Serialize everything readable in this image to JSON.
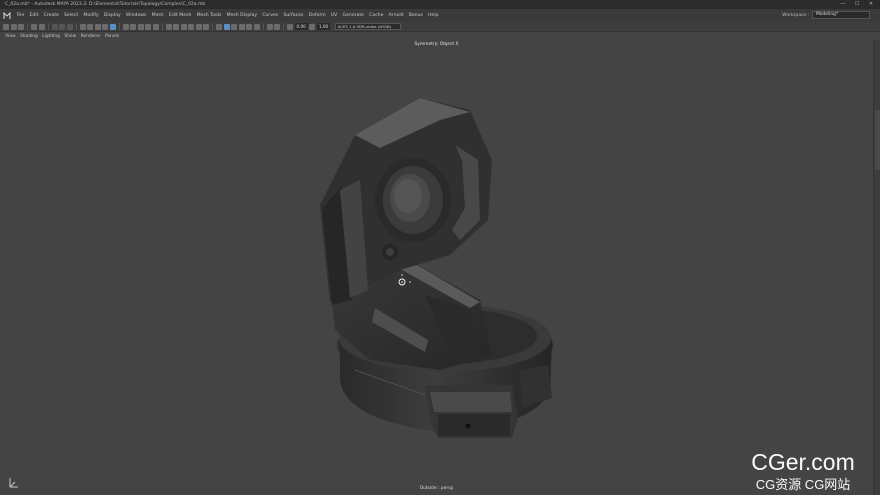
{
  "window": {
    "title": "C_02a.mb* - Autodesk MAYA 2023.3: D:\\Elemental\\Tutorials\\Topology\\Complex\\C_02a.mb",
    "min": "—",
    "max": "☐",
    "close": "✕"
  },
  "menubar": {
    "items": [
      "File",
      "Edit",
      "Create",
      "Select",
      "Modify",
      "Display",
      "Windows",
      "Mesh",
      "Edit Mesh",
      "Mesh Tools",
      "Mesh Display",
      "Curves",
      "Surfaces",
      "Deform",
      "UV",
      "Generate",
      "Cache",
      "Arnold",
      "Bonus",
      "Help"
    ],
    "workspace_label": "Workspace :",
    "workspace_value": "Modeling*"
  },
  "shelf": {
    "value_a": "0.00",
    "value_b": "1.00",
    "color_space": "ACES 1.0 SDR-video (sRGB)"
  },
  "panel_menu": [
    "View",
    "Shading",
    "Lighting",
    "Show",
    "Renderer",
    "Panels"
  ],
  "viewport": {
    "symmetry_label": "Symmetry: Object X",
    "camera_label": "Outside : persp",
    "axis_icon": "axis-gizmo-icon"
  },
  "watermark": {
    "line1": "CGer.com",
    "line2": "CG资源  CG网站"
  },
  "colors": {
    "viewport_bg": "#444444",
    "model_base": "#2f2f2f",
    "model_highlight": "#6a6a6a",
    "accent": "#5b8fc7"
  }
}
